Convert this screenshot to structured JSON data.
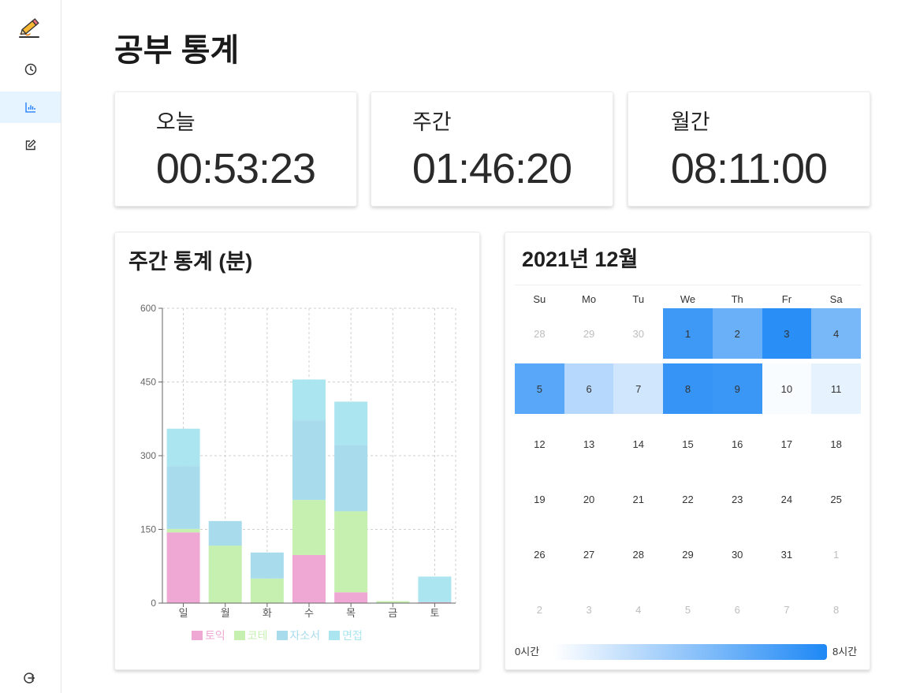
{
  "sidebar": {
    "logo_icon": "pencil-logo-icon",
    "items": [
      {
        "icon": "clock-icon",
        "active": false
      },
      {
        "icon": "bar-chart-icon",
        "active": true
      },
      {
        "icon": "edit-icon",
        "active": false
      }
    ],
    "logout_icon": "logout-icon",
    "accent_color": "#1677ff"
  },
  "page": {
    "title": "공부 통계"
  },
  "stats": [
    {
      "label": "오늘",
      "value": "00:53:23"
    },
    {
      "label": "주간",
      "value": "01:46:20"
    },
    {
      "label": "월간",
      "value": "08:11:00"
    }
  ],
  "chart_data": {
    "type": "bar",
    "stacked": true,
    "title": "주간 통계 (분)",
    "xlabel": "",
    "ylabel": "",
    "categories": [
      "일",
      "월",
      "화",
      "수",
      "목",
      "금",
      "토"
    ],
    "yticks": [
      0,
      150,
      300,
      450,
      600
    ],
    "ylim": [
      0,
      600
    ],
    "grid": true,
    "legend": "bottom",
    "series": [
      {
        "name": "토익",
        "color": "#efa8d3",
        "values": [
          144,
          0,
          0,
          98,
          22,
          0,
          2
        ]
      },
      {
        "name": "코테",
        "color": "#c6f0b0",
        "values": [
          7,
          117,
          50,
          112,
          165,
          4,
          0
        ]
      },
      {
        "name": "자소서",
        "color": "#a8dced",
        "values": [
          128,
          50,
          53,
          162,
          135,
          0,
          0
        ]
      },
      {
        "name": "면접",
        "color": "#abe5f0",
        "values": [
          76,
          0,
          0,
          83,
          88,
          0,
          52
        ]
      }
    ]
  },
  "calendar": {
    "title": "2021년 12월",
    "weekdays": [
      "Su",
      "Mo",
      "Tu",
      "We",
      "Th",
      "Fr",
      "Sa"
    ],
    "weeks": [
      [
        {
          "day": "28",
          "muted": true
        },
        {
          "day": "29",
          "muted": true
        },
        {
          "day": "30",
          "muted": true
        },
        {
          "day": "1",
          "hours": 6.9
        },
        {
          "day": "2",
          "hours": 5.3
        },
        {
          "day": "3",
          "hours": 7.6
        },
        {
          "day": "4",
          "hours": 4.8
        }
      ],
      [
        {
          "day": "5",
          "hours": 5.9
        },
        {
          "day": "6",
          "hours": 2.6
        },
        {
          "day": "7",
          "hours": 1.7
        },
        {
          "day": "8",
          "hours": 7.2
        },
        {
          "day": "9",
          "hours": 7.0
        },
        {
          "day": "10",
          "hours": 0.2
        },
        {
          "day": "11",
          "hours": 0.9
        }
      ],
      [
        {
          "day": "12"
        },
        {
          "day": "13"
        },
        {
          "day": "14"
        },
        {
          "day": "15"
        },
        {
          "day": "16"
        },
        {
          "day": "17"
        },
        {
          "day": "18"
        }
      ],
      [
        {
          "day": "19"
        },
        {
          "day": "20"
        },
        {
          "day": "21"
        },
        {
          "day": "22"
        },
        {
          "day": "23"
        },
        {
          "day": "24"
        },
        {
          "day": "25"
        }
      ],
      [
        {
          "day": "26"
        },
        {
          "day": "27"
        },
        {
          "day": "28"
        },
        {
          "day": "29"
        },
        {
          "day": "30"
        },
        {
          "day": "31"
        },
        {
          "day": "1",
          "muted": true
        }
      ],
      [
        {
          "day": "2",
          "muted": true
        },
        {
          "day": "3",
          "muted": true
        },
        {
          "day": "4",
          "muted": true
        },
        {
          "day": "5",
          "muted": true
        },
        {
          "day": "6",
          "muted": true
        },
        {
          "day": "7",
          "muted": true
        },
        {
          "day": "8",
          "muted": true
        }
      ]
    ],
    "legend": {
      "min_label": "0시간",
      "max_label": "8시간",
      "min_hours": 0,
      "max_hours": 8,
      "color_from": "#ffffff",
      "color_to": "#1e88f5"
    }
  }
}
